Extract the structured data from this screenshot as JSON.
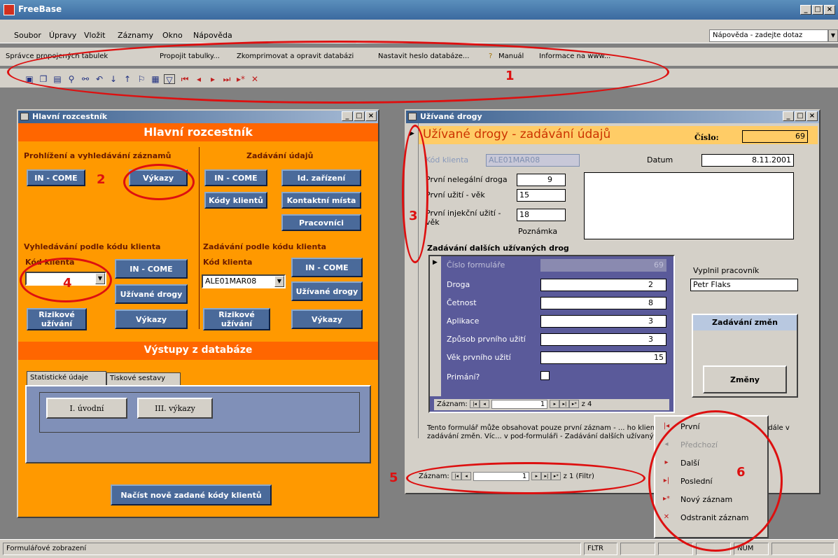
{
  "app": {
    "title": "FreeBase",
    "status": "Formulářové zobrazení",
    "status_fltr": "FLTR",
    "status_num": "NUM"
  },
  "menu": [
    "Soubor",
    "Úpravy",
    "Vložit",
    "Záznamy",
    "Okno",
    "Nápověda"
  ],
  "help_placeholder": "Nápověda - zadejte dotaz",
  "toolbar1": [
    "Správce propojených tabulek",
    "Propojit tabulky...",
    "Zkomprimovat a opravit databázi",
    "Nastavit heslo databáze...",
    "Manuál",
    "Informace na www..."
  ],
  "hr": {
    "title": "Hlavní rozcestník",
    "header": "Hlavní rozcestník",
    "sec_browse": "Prohlížení a vyhledávání záznamů",
    "sec_entry": "Zadávání údajů",
    "btn_income": "IN - COME",
    "btn_vykazy": "Výkazy",
    "btn_income2": "IN - COME",
    "btn_id": "Id. zařízení",
    "btn_kody": "Kódy klientů",
    "btn_kontakt": "Kontaktní místa",
    "btn_prac": "Pracovníci",
    "sec_search": "Vyhledávání podle kódu klienta",
    "sec_entry2": "Zadávání podle kódu klienta",
    "kod": "Kód klienta",
    "kod2": "Kód klienta",
    "kod2_val": "ALE01MAR08",
    "btn_income3": "IN - COME",
    "btn_drogy": "Užívané drogy",
    "btn_riziko": "Rizikové užívání",
    "btn_vykazy2": "Výkazy",
    "btn_income4": "IN - COME",
    "btn_drogy2": "Užívané drogy",
    "btn_riziko2": "Rizikové užívání",
    "btn_vykazy3": "Výkazy",
    "out_header": "Výstupy z databáze",
    "tab1": "Statistické údaje",
    "tab2": "Tiskové sestavy",
    "btn_uvodni": "I. úvodní",
    "btn_vykazy4": "III. výkazy",
    "btn_load": "Načíst nově zadané kódy klientů"
  },
  "ud": {
    "title": "Užívané drogy",
    "header": "Užívané drogy - zadávání údajů",
    "cislo_lbl": "Číslo:",
    "cislo": "69",
    "kod_lbl": "Kód klienta",
    "kod_val": "ALE01MAR08",
    "datum_lbl": "Datum",
    "datum": "8.11.2001",
    "prvni_lbl": "První nelegální droga",
    "prvni_val": "9",
    "uziti_lbl": "První užití - věk",
    "uziti_val": "15",
    "inj_lbl": "První injekční užití - věk",
    "inj_val": "18",
    "poznamka": "Poznámka",
    "sub_hdr": "Zadávání dalších užívaných drog",
    "sub": {
      "cislo_lbl": "Číslo formuláře",
      "cislo": "69",
      "droga": "Droga",
      "droga_v": "2",
      "cetnost": "Četnost",
      "cetnost_v": "8",
      "aplikace": "Aplikace",
      "aplikace_v": "3",
      "zpusob": "Způsob prvního užití",
      "zpusob_v": "3",
      "vek": "Věk prvního užití",
      "vek_v": "15",
      "primani": "Primání?"
    },
    "sub_nav": {
      "lbl": "Záznam:",
      "val": "1",
      "of": "z 4"
    },
    "vyplnil_lbl": "Vyplnil pracovník",
    "vyplnil": "Petr Flaks",
    "zmen_hdr": "Zadávání změn",
    "zmen_btn": "Změny",
    "note": "Tento formulář může obsahovat pouze první záznam - ... ho klienta! Drogovou kariéru sledujeme dále v zadávání změn. Víc... v pod-formuláři - Zadávání dalších užívaných drog.",
    "nav": {
      "lbl": "Záznam:",
      "val": "1",
      "of": "z 1 (Filtr)"
    }
  },
  "ctx": [
    "První",
    "Předchozí",
    "Další",
    "Poslední",
    "Nový záznam",
    "Odstranit záznam"
  ],
  "annotations": [
    "1",
    "2",
    "3",
    "4",
    "5",
    "6"
  ]
}
